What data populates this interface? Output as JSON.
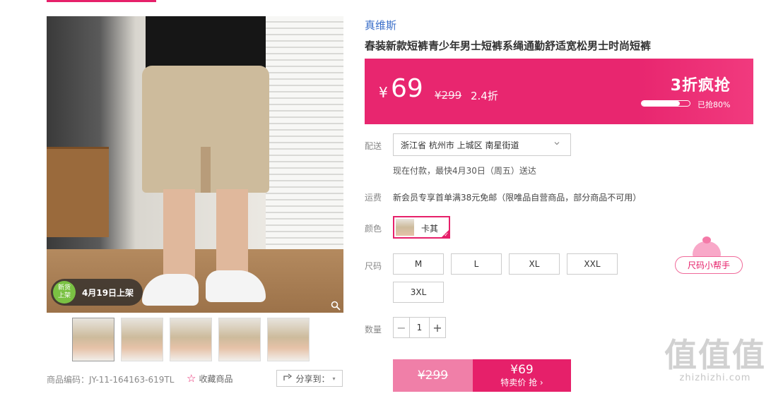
{
  "gallery": {
    "badge_new": "新货上架",
    "badge_new_line1": "新货",
    "badge_new_line2": "上架",
    "badge_date": "4月19日上架",
    "thumbnail_count": 5
  },
  "product": {
    "code_label": "商品编码：JY-11-164163-619TL",
    "favorite_label": "收藏商品",
    "share_label": "分享到：",
    "brand": "真维斯",
    "title": "春装新款短裤青少年男士短裤系绳通勤舒适宽松男士时尚短裤"
  },
  "price": {
    "currency": "¥",
    "current": "69",
    "original": "¥299",
    "discount": "2.4折",
    "promo": "3折疯抢",
    "sold_percent": 80,
    "sold_label": "已抢80%"
  },
  "delivery": {
    "label": "配送",
    "address": "浙江省 杭州市 上城区 南星街道",
    "note": "现在付款，最快4月30日（周五）送达"
  },
  "shipping": {
    "label": "运费",
    "info": "新会员专享首单满38元免邮（限唯品自营商品，部分商品不可用）"
  },
  "color": {
    "label": "颜色",
    "selected": "卡其"
  },
  "size": {
    "label": "尺码",
    "options": [
      "M",
      "L",
      "XL",
      "XXL",
      "3XL"
    ],
    "helper": "尺码小帮手"
  },
  "quantity": {
    "label": "数量",
    "value": "1",
    "minus": "−",
    "plus": "+"
  },
  "buy": {
    "original": "¥299",
    "price": "¥69",
    "action": "特卖价 抢 ›"
  },
  "watermark": {
    "big": "值值值",
    "small": "zhizhizhi.com"
  },
  "colors": {
    "accent": "#e6206a",
    "brand_link": "#3b6fc9"
  }
}
